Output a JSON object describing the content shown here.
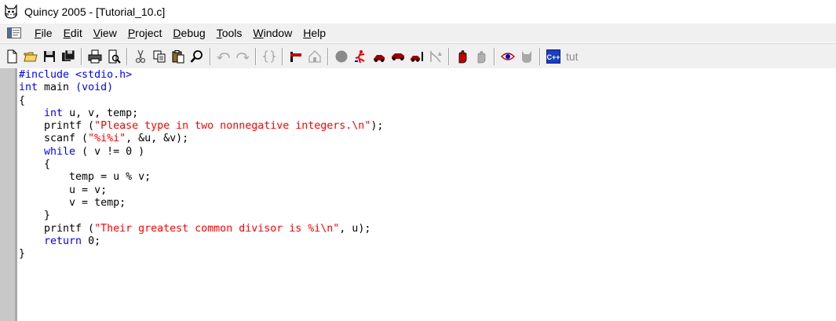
{
  "window": {
    "title": "Quincy 2005 - [Tutorial_10.c]",
    "app_icon": "cat-icon"
  },
  "menu": {
    "items": [
      {
        "label": "File",
        "access": "F",
        "rest": "ile"
      },
      {
        "label": "Edit",
        "access": "E",
        "rest": "dit"
      },
      {
        "label": "View",
        "access": "V",
        "rest": "iew"
      },
      {
        "label": "Project",
        "access": "P",
        "rest": "roject"
      },
      {
        "label": "Debug",
        "access": "D",
        "rest": "ebug"
      },
      {
        "label": "Tools",
        "access": "T",
        "rest": "ools"
      },
      {
        "label": "Window",
        "access": "W",
        "rest": "indow"
      },
      {
        "label": "Help",
        "access": "H",
        "rest": "elp"
      }
    ]
  },
  "toolbar": {
    "buttons": [
      "new-file-icon",
      "open-folder-icon",
      "save-icon",
      "save-all-icon",
      "print-icon",
      "print-preview-icon",
      "cut-icon",
      "copy-icon",
      "paste-icon",
      "find-icon",
      "undo-icon",
      "redo-icon",
      "brace-match-icon",
      "build-icon",
      "home-icon",
      "stop-icon",
      "run-icon",
      "step-icon",
      "step-over-icon",
      "step-into-icon",
      "run-to-cursor-icon",
      "hand-icon",
      "breakpoint-disabled-icon",
      "watch-icon",
      "quincy-icon",
      "cpp-icon"
    ],
    "tut_label": "tut"
  },
  "editor": {
    "lines": [
      [
        {
          "t": "#include <stdio.h>",
          "c": "kw"
        }
      ],
      [
        {
          "t": "int",
          "c": "kw"
        },
        {
          "t": " main ",
          "c": ""
        },
        {
          "t": "(void)",
          "c": "kw"
        }
      ],
      [
        {
          "t": "{",
          "c": ""
        }
      ],
      [
        {
          "t": "    ",
          "c": ""
        },
        {
          "t": "int",
          "c": "kw"
        },
        {
          "t": " u, v, temp;",
          "c": ""
        }
      ],
      [
        {
          "t": "    printf (",
          "c": ""
        },
        {
          "t": "\"Please type in two nonnegative integers.\\n\"",
          "c": "str"
        },
        {
          "t": ");",
          "c": ""
        }
      ],
      [
        {
          "t": "    scanf (",
          "c": ""
        },
        {
          "t": "\"%i%i\"",
          "c": "str"
        },
        {
          "t": ", &u, &v);",
          "c": ""
        }
      ],
      [
        {
          "t": "    ",
          "c": ""
        },
        {
          "t": "while",
          "c": "kw"
        },
        {
          "t": " ( v != 0 )",
          "c": ""
        }
      ],
      [
        {
          "t": "    {",
          "c": ""
        }
      ],
      [
        {
          "t": "        temp = u % v;",
          "c": ""
        }
      ],
      [
        {
          "t": "        u = v;",
          "c": ""
        }
      ],
      [
        {
          "t": "        v = temp;",
          "c": ""
        }
      ],
      [
        {
          "t": "    }",
          "c": ""
        }
      ],
      [
        {
          "t": "    printf (",
          "c": ""
        },
        {
          "t": "\"Their greatest common divisor is %i\\n\"",
          "c": "str"
        },
        {
          "t": ", u);",
          "c": ""
        }
      ],
      [
        {
          "t": "    ",
          "c": ""
        },
        {
          "t": "return",
          "c": "kw"
        },
        {
          "t": " 0;",
          "c": ""
        }
      ],
      [
        {
          "t": "}",
          "c": ""
        }
      ]
    ]
  },
  "colors": {
    "keyword": "#0000ff",
    "string": "#ff0000",
    "gutter": "#c8c8c8",
    "chrome": "#f0f0f0"
  }
}
